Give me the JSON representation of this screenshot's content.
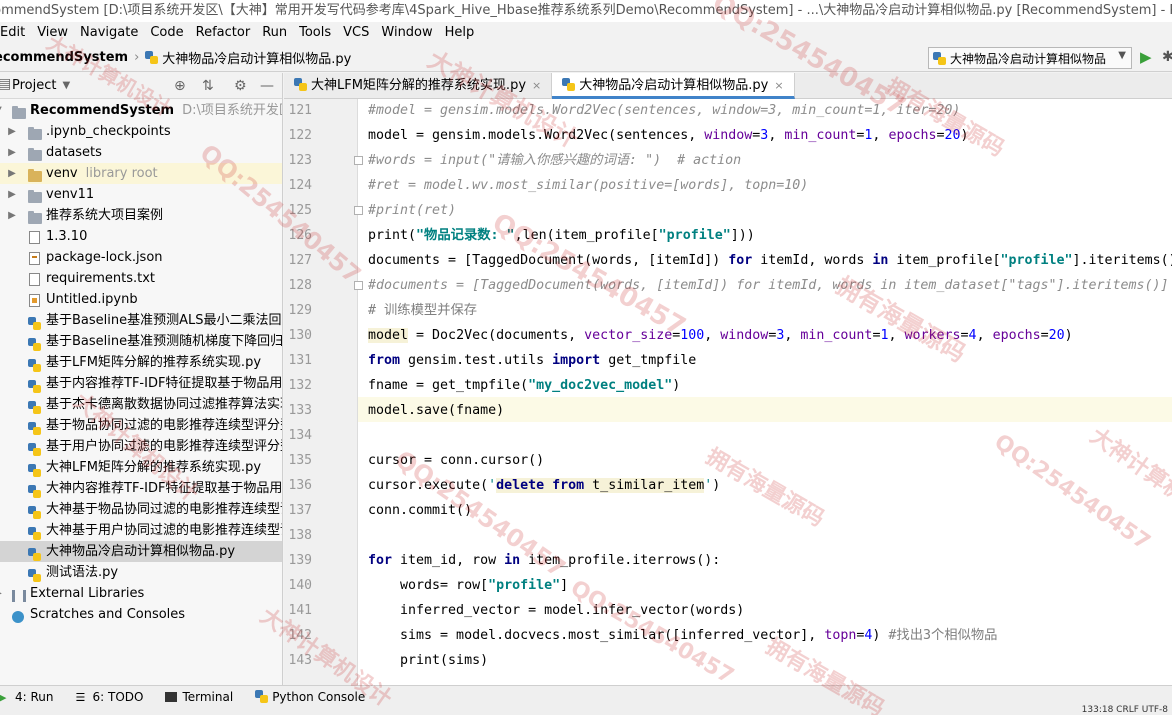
{
  "window": {
    "title": "commendSystem [D:\\项目系统开发区\\【大神】常用开发写代码参考库\\4Spark_Hive_Hbase推荐系统系列Demo\\RecommendSystem] - ...\\大神物品冷启动计算相似物品.py [RecommendSystem] - PyCharm (Administ"
  },
  "menu": [
    "Edit",
    "View",
    "Navigate",
    "Code",
    "Refactor",
    "Run",
    "Tools",
    "VCS",
    "Window",
    "Help"
  ],
  "nav": {
    "project": "ecommendSystem",
    "file": "大神物品冷启动计算相似物品.py"
  },
  "run_config": {
    "label": "大神物品冷启动计算相似物品"
  },
  "project_panel": {
    "title": "Project",
    "items": [
      {
        "label": "RecommendSystem",
        "extra": "D:\\项目系统开发区\\【大",
        "type": "root"
      },
      {
        "label": ".ipynb_checkpoints",
        "type": "folder"
      },
      {
        "label": "datasets",
        "type": "folder"
      },
      {
        "label": "venv",
        "extra": "library root",
        "type": "folder-yellow"
      },
      {
        "label": "venv11",
        "type": "folder"
      },
      {
        "label": "推荐系统大项目案例",
        "type": "folder"
      },
      {
        "label": "1.3.10",
        "type": "file"
      },
      {
        "label": "package-lock.json",
        "type": "json"
      },
      {
        "label": "requirements.txt",
        "type": "file"
      },
      {
        "label": "Untitled.ipynb",
        "type": "nb"
      },
      {
        "label": "基于Baseline基准预测ALS最小二乘法回归模",
        "type": "py"
      },
      {
        "label": "基于Baseline基准预测随机梯度下降回归模型",
        "type": "py"
      },
      {
        "label": "基于LFM矩阵分解的推荐系统实现.py",
        "type": "py"
      },
      {
        "label": "基于内容推荐TF-IDF特征提取基于物品用户画",
        "type": "py"
      },
      {
        "label": "基于杰卡德离散数据协同过滤推荐算法实现.p",
        "type": "py"
      },
      {
        "label": "基于物品协同过滤的电影推荐连续型评分型.p",
        "type": "py"
      },
      {
        "label": "基于用户协同过滤的电影推荐连续型评分型.p",
        "type": "py"
      },
      {
        "label": "大神LFM矩阵分解的推荐系统实现.py",
        "type": "py"
      },
      {
        "label": "大神内容推荐TF-IDF特征提取基于物品用户画",
        "type": "py"
      },
      {
        "label": "大神基于物品协同过滤的电影推荐连续型评分",
        "type": "py"
      },
      {
        "label": "大神基于用户协同过滤的电影推荐连续型评分",
        "type": "py"
      },
      {
        "label": "大神物品冷启动计算相似物品.py",
        "type": "py"
      },
      {
        "label": "测试语法.py",
        "type": "py"
      },
      {
        "label": "External Libraries",
        "type": "lib"
      },
      {
        "label": "Scratches and Consoles",
        "type": "scratch"
      }
    ]
  },
  "tabs": [
    {
      "label": "大神LFM矩阵分解的推荐系统实现.py",
      "close": "×"
    },
    {
      "label": "大神物品冷启动计算相似物品.py",
      "close": "×"
    }
  ],
  "editor": {
    "line_numbers": [
      "121",
      "122",
      "123",
      "124",
      "125",
      "126",
      "127",
      "128",
      "129",
      "130",
      "131",
      "132",
      "133",
      "134",
      "135",
      "136",
      "137",
      "138",
      "139",
      "140",
      "141",
      "142",
      "143"
    ],
    "lines": [
      [
        {
          "t": "#model = gensim.models.Word2Vec(sentences, window=3, min_count=1, iter=20)",
          "c": "cmt"
        }
      ],
      [
        {
          "t": "model = gensim.models.Word2Vec(sentences, ",
          "c": ""
        },
        {
          "t": "window",
          "c": "param"
        },
        {
          "t": "=",
          "c": ""
        },
        {
          "t": "3",
          "c": "num"
        },
        {
          "t": ", ",
          "c": ""
        },
        {
          "t": "min_count",
          "c": "param"
        },
        {
          "t": "=",
          "c": ""
        },
        {
          "t": "1",
          "c": "num"
        },
        {
          "t": ", ",
          "c": ""
        },
        {
          "t": "epochs",
          "c": "param"
        },
        {
          "t": "=",
          "c": ""
        },
        {
          "t": "20",
          "c": "num"
        },
        {
          "t": ")",
          "c": ""
        }
      ],
      [
        {
          "t": "#words = input(\"请输入你感兴趣的词语: \")  # action",
          "c": "cmt"
        }
      ],
      [
        {
          "t": "#ret = model.wv.most_similar(positive=[words], topn=10)",
          "c": "cmt"
        }
      ],
      [
        {
          "t": "#print(ret)",
          "c": "cmt"
        }
      ],
      [
        {
          "t": "print(",
          "c": ""
        },
        {
          "t": "\"物品记录数: \"",
          "c": "str"
        },
        {
          "t": ",len(item_profile[",
          "c": ""
        },
        {
          "t": "\"profile\"",
          "c": "str"
        },
        {
          "t": "]))",
          "c": ""
        }
      ],
      [
        {
          "t": "documents = [TaggedDocument(words, [itemId]) ",
          "c": ""
        },
        {
          "t": "for",
          "c": "kw"
        },
        {
          "t": " itemId, words ",
          "c": ""
        },
        {
          "t": "in",
          "c": "kw"
        },
        {
          "t": " item_profile[",
          "c": ""
        },
        {
          "t": "\"profile\"",
          "c": "str"
        },
        {
          "t": "].iteritems()]",
          "c": ""
        }
      ],
      [
        {
          "t": "#documents = [TaggedDocument(words, [itemId]) for itemId, words in item_dataset[\"tags\"].iteritems()]",
          "c": "cmt"
        }
      ],
      [
        {
          "t": "# 训练模型并保存",
          "c": "cn"
        }
      ],
      [
        {
          "t": "model",
          "c": "sql"
        },
        {
          "t": " = Doc2Vec(documents, ",
          "c": ""
        },
        {
          "t": "vector_size",
          "c": "param"
        },
        {
          "t": "=",
          "c": ""
        },
        {
          "t": "100",
          "c": "num"
        },
        {
          "t": ", ",
          "c": ""
        },
        {
          "t": "window",
          "c": "param"
        },
        {
          "t": "=",
          "c": ""
        },
        {
          "t": "3",
          "c": "num"
        },
        {
          "t": ", ",
          "c": ""
        },
        {
          "t": "min_count",
          "c": "param"
        },
        {
          "t": "=",
          "c": ""
        },
        {
          "t": "1",
          "c": "num"
        },
        {
          "t": ", ",
          "c": ""
        },
        {
          "t": "workers",
          "c": "param"
        },
        {
          "t": "=",
          "c": ""
        },
        {
          "t": "4",
          "c": "num"
        },
        {
          "t": ", ",
          "c": ""
        },
        {
          "t": "epochs",
          "c": "param"
        },
        {
          "t": "=",
          "c": ""
        },
        {
          "t": "20",
          "c": "num"
        },
        {
          "t": ")",
          "c": ""
        }
      ],
      [
        {
          "t": "from",
          "c": "kw"
        },
        {
          "t": " gensim.test.utils ",
          "c": ""
        },
        {
          "t": "import",
          "c": "kw"
        },
        {
          "t": " get_tmpfile",
          "c": ""
        }
      ],
      [
        {
          "t": "fname = get_tmpfile(",
          "c": ""
        },
        {
          "t": "\"my_doc2vec_model\"",
          "c": "str"
        },
        {
          "t": ")",
          "c": ""
        }
      ],
      [
        {
          "t": "model.save(fname)",
          "c": ""
        }
      ],
      [
        {
          "t": "",
          "c": ""
        }
      ],
      [
        {
          "t": "cursor = conn.cursor()",
          "c": ""
        }
      ],
      [
        {
          "t": "cursor.execute(",
          "c": ""
        },
        {
          "t": "'",
          "c": "str2"
        },
        {
          "t": "delete from",
          "c": "kw sql"
        },
        {
          "t": " t_similar_item",
          "c": "sql"
        },
        {
          "t": "'",
          "c": "str2"
        },
        {
          "t": ")",
          "c": ""
        }
      ],
      [
        {
          "t": "conn.commit()",
          "c": ""
        }
      ],
      [
        {
          "t": "",
          "c": ""
        }
      ],
      [
        {
          "t": "for",
          "c": "kw"
        },
        {
          "t": " item_id, row ",
          "c": ""
        },
        {
          "t": "in",
          "c": "kw"
        },
        {
          "t": " item_profile.iterrows():",
          "c": ""
        }
      ],
      [
        {
          "t": "    words= row[",
          "c": ""
        },
        {
          "t": "\"profile\"",
          "c": "str"
        },
        {
          "t": "]",
          "c": ""
        }
      ],
      [
        {
          "t": "    inferred_vector = model.infer_vector(words)",
          "c": ""
        }
      ],
      [
        {
          "t": "    sims = model.docvecs.most_similar([inferred_vector], ",
          "c": ""
        },
        {
          "t": "topn",
          "c": "param"
        },
        {
          "t": "=",
          "c": ""
        },
        {
          "t": "4",
          "c": "num"
        },
        {
          "t": ") ",
          "c": ""
        },
        {
          "t": "#找出3个相似物品",
          "c": "cn"
        }
      ],
      [
        {
          "t": "    print(sims)",
          "c": ""
        }
      ]
    ]
  },
  "bottom_tools": [
    {
      "label": "4: Run"
    },
    {
      "label": "6: TODO"
    },
    {
      "label": "Terminal"
    },
    {
      "label": "Python Console"
    }
  ],
  "status": {
    "position": "133:18  CRLF  UTF-8"
  },
  "watermarks": [
    "大神计算机设计",
    "QQ:254540457",
    "拥有海量源码"
  ],
  "colors": {
    "keyword": "#000080",
    "string": "#008080",
    "param": "#660099",
    "number": "#0000ff",
    "comment": "#8c8c8c",
    "selection_tab": "#4083c9",
    "watermark": "#c82828"
  }
}
